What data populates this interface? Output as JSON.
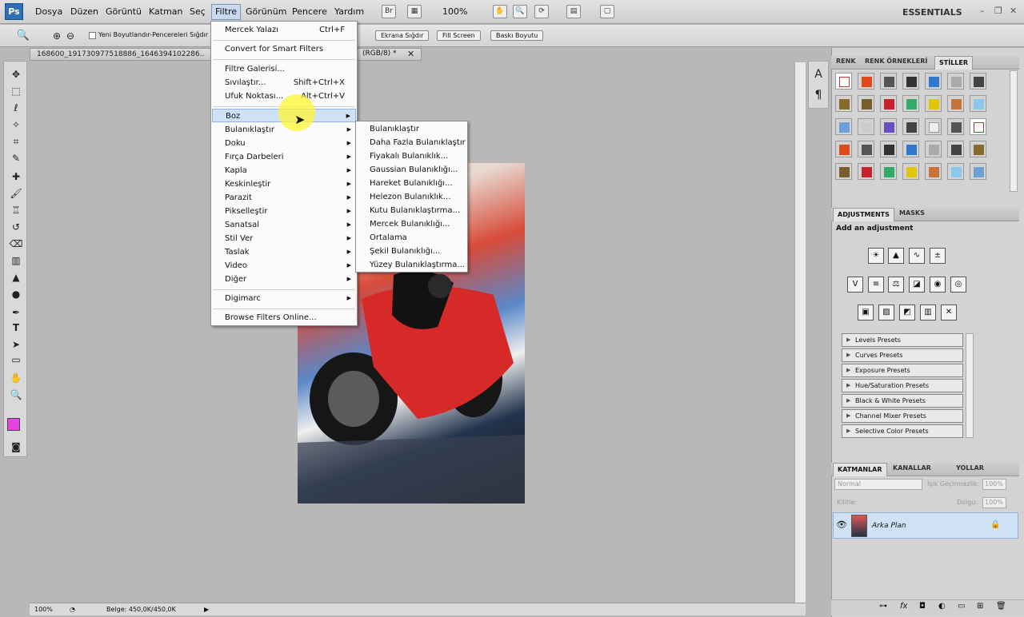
{
  "app": {
    "logo": "Ps",
    "workspace": "ESSENTIALS"
  },
  "menubar": {
    "items": [
      "Dosya",
      "Düzen",
      "Görüntü",
      "Katman",
      "Seç",
      "Filtre",
      "Görünüm",
      "Pencere",
      "Yardım"
    ],
    "zoom": "100%",
    "bridge": "Br"
  },
  "options": {
    "checkbox_label": "Yeni Boyutlandır-Pencereleri Sığdır",
    "btn_fit": "Ekrana Sığdır",
    "btn_fill": "Fill Screen",
    "btn_print": "Baskı Boyutu"
  },
  "document": {
    "tab_title": "168600_191730977518886_1646394102286..",
    "tab_suffix": "(RGB/8) *",
    "zoom": "100%",
    "status": "Belge: 450,0K/450,0K"
  },
  "filter_menu": {
    "items": [
      {
        "label": "Mercek Yalazı",
        "shortcut": "Ctrl+F"
      },
      {
        "label": "Convert for Smart Filters"
      },
      {
        "label": "Filtre Galerisi..."
      },
      {
        "label": "Sıvılaştır...",
        "shortcut": "Shift+Ctrl+X"
      },
      {
        "label": "Ufuk Noktası...",
        "shortcut": "Alt+Ctrl+V"
      },
      {
        "label": "Boz"
      },
      {
        "label": "Bulanıklaştır"
      },
      {
        "label": "Doku"
      },
      {
        "label": "Fırça Darbeleri"
      },
      {
        "label": "Kapla"
      },
      {
        "label": "Keskinleştir"
      },
      {
        "label": "Parazit"
      },
      {
        "label": "Pikselleştir"
      },
      {
        "label": "Sanatsal"
      },
      {
        "label": "Stil Ver"
      },
      {
        "label": "Taslak"
      },
      {
        "label": "Video"
      },
      {
        "label": "Diğer"
      },
      {
        "label": "Digimarc"
      },
      {
        "label": "Browse Filters Online..."
      }
    ]
  },
  "blur_submenu": {
    "items": [
      "Bulanıklaştır",
      "Daha Fazla Bulanıklaştır",
      "Fiyakalı Bulanıklık...",
      "Gaussian Bulanıklığı...",
      "Hareket Bulanıklığı...",
      "Helezon Bulanıklık...",
      "Kutu Bulanıklaştırma...",
      "Mercek Bulanıklığı...",
      "Ortalama",
      "Şekil Bulanıklığı...",
      "Yüzey Bulanıklaştırma..."
    ]
  },
  "styles_panel": {
    "tabs": [
      "RENK",
      "RENK ÖRNEKLERİ",
      "STİLLER"
    ]
  },
  "adjustments_panel": {
    "tabs": [
      "ADJUSTMENTS",
      "MASKS"
    ],
    "heading": "Add an adjustment",
    "presets": [
      "Levels Presets",
      "Curves Presets",
      "Exposure Presets",
      "Hue/Saturation Presets",
      "Black & White Presets",
      "Channel Mixer Presets",
      "Selective Color Presets"
    ]
  },
  "layers_panel": {
    "tabs": [
      "KATMANLAR",
      "KANALLAR",
      "YOLLAR"
    ],
    "blend_mode": "Normal",
    "opacity_label": "Işık Geçirmezlik:",
    "opacity": "100%",
    "lock_label": "Kilitle:",
    "fill_label": "Dolgu:",
    "fill": "100%",
    "layer_name": "Arka Plan"
  }
}
